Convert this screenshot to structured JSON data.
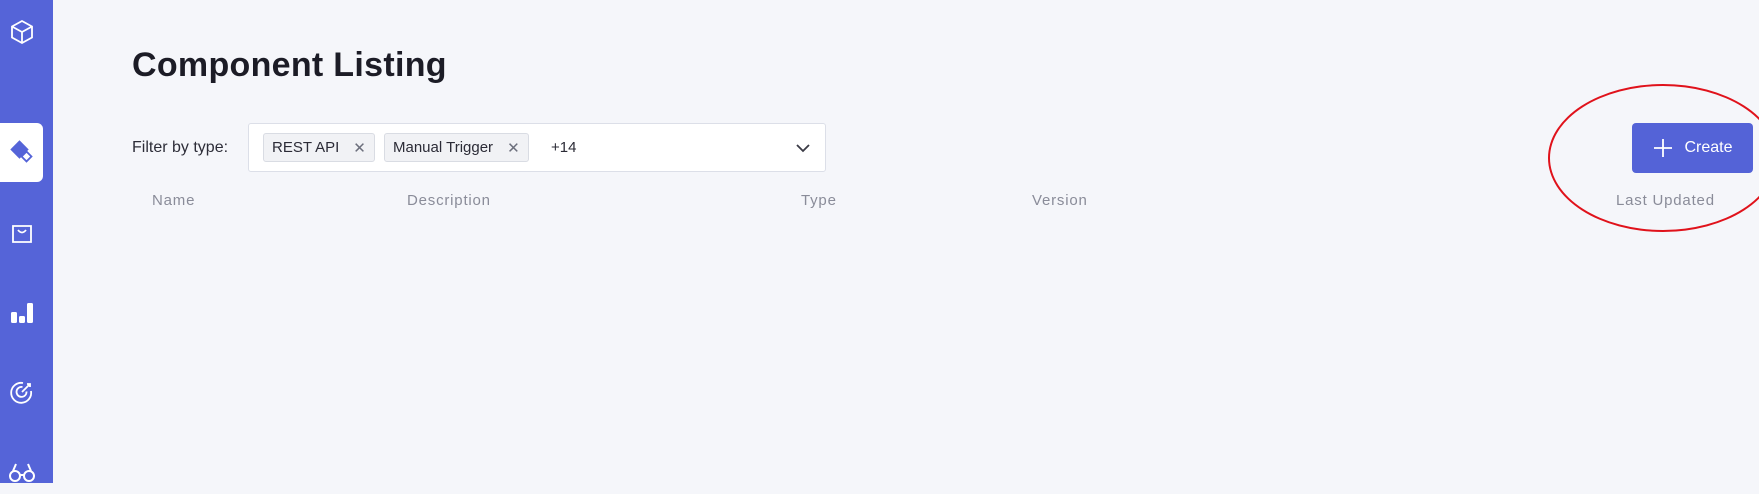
{
  "page": {
    "title": "Component Listing"
  },
  "sidebar": {
    "items": [
      {
        "icon": "cube-icon",
        "active": false
      },
      {
        "icon": "components-icon",
        "active": true
      },
      {
        "icon": "shopping-bag-icon",
        "active": false
      },
      {
        "icon": "bar-chart-icon",
        "active": false
      },
      {
        "icon": "target-icon",
        "active": false
      },
      {
        "icon": "binoculars-icon",
        "active": false
      }
    ],
    "accent": "#5564d8"
  },
  "filter": {
    "label": "Filter by type:",
    "chips": [
      {
        "label": "REST API"
      },
      {
        "label": "Manual Trigger"
      }
    ],
    "more_count": "+14"
  },
  "toolbar": {
    "create_label": "Create",
    "create_color": "#5463d7"
  },
  "table": {
    "columns": [
      "Name",
      "Description",
      "Type",
      "Version",
      "Last Updated"
    ]
  },
  "annotation": {
    "shape": "circle",
    "color": "#e0121b",
    "target": "create-button"
  }
}
